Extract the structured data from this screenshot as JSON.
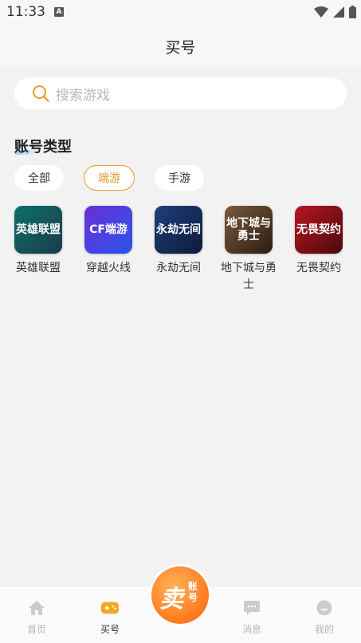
{
  "status_bar": {
    "time": "11:33",
    "a_icon": "A"
  },
  "nav": {
    "title": "买号"
  },
  "search": {
    "placeholder": "搜索游戏"
  },
  "section": {
    "title": "账号类型"
  },
  "filters": [
    {
      "label": "全部",
      "active": false
    },
    {
      "label": "端游",
      "active": true
    },
    {
      "label": "手游",
      "active": false
    }
  ],
  "games": [
    {
      "name": "英雄联盟",
      "logo_text": "英雄联盟",
      "color1": "#0e6f6b",
      "color2": "#1a3b4a"
    },
    {
      "name": "穿越火线",
      "logo_text": "CF端游",
      "color1": "#6a2fd6",
      "color2": "#2a55e8"
    },
    {
      "name": "永劫无间",
      "logo_text": "永劫无间",
      "color1": "#1d3f7a",
      "color2": "#0c1c3a"
    },
    {
      "name": "地下城与勇士",
      "logo_text": "地下城与勇士",
      "color1": "#7a5a3a",
      "color2": "#2a1e14"
    },
    {
      "name": "无畏契约",
      "logo_text": "无畏契约",
      "color1": "#b8161f",
      "color2": "#4a0a0e"
    }
  ],
  "sell_button": {
    "main": "卖",
    "sub": "账号"
  },
  "tabs": [
    {
      "label": "首页",
      "icon": "home-icon",
      "active": false
    },
    {
      "label": "买号",
      "icon": "gamepad-icon",
      "active": true
    },
    {
      "label": "消息",
      "icon": "message-icon",
      "active": false
    },
    {
      "label": "我的",
      "icon": "profile-icon",
      "active": false
    }
  ],
  "colors": {
    "accent": "#e89a2c",
    "sell_orange": "#ff7a1c"
  }
}
